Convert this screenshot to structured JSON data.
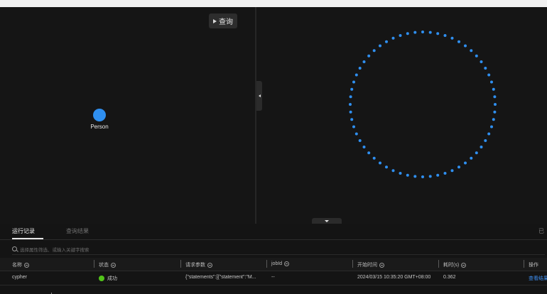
{
  "toolbar": {
    "run_label": "查询"
  },
  "graph": {
    "node_label": "Person",
    "node_color": "#2f8ff0",
    "ring_color": "#2f8ff0"
  },
  "tabs": {
    "active": "运行记录",
    "inactive": "查询结果",
    "right_text": "已"
  },
  "filter": {
    "placeholder": "选择属性筛选、或输入关键字搜索"
  },
  "table": {
    "columns": [
      "名称",
      "状态",
      "请求参数",
      "jobId",
      "开始时间",
      "耗时(s)",
      "操作"
    ],
    "rows": [
      {
        "name": "cypher",
        "status": "成功",
        "params": "{\"statements\":[{\"statement\":\"M...",
        "jobId": "--",
        "start": "2024/03/15 10:35:20 GMT+08:00",
        "duration": "0.362",
        "action": "查看结果"
      }
    ]
  },
  "colors": {
    "success": "#52c41a",
    "link": "#3d8ef0"
  }
}
